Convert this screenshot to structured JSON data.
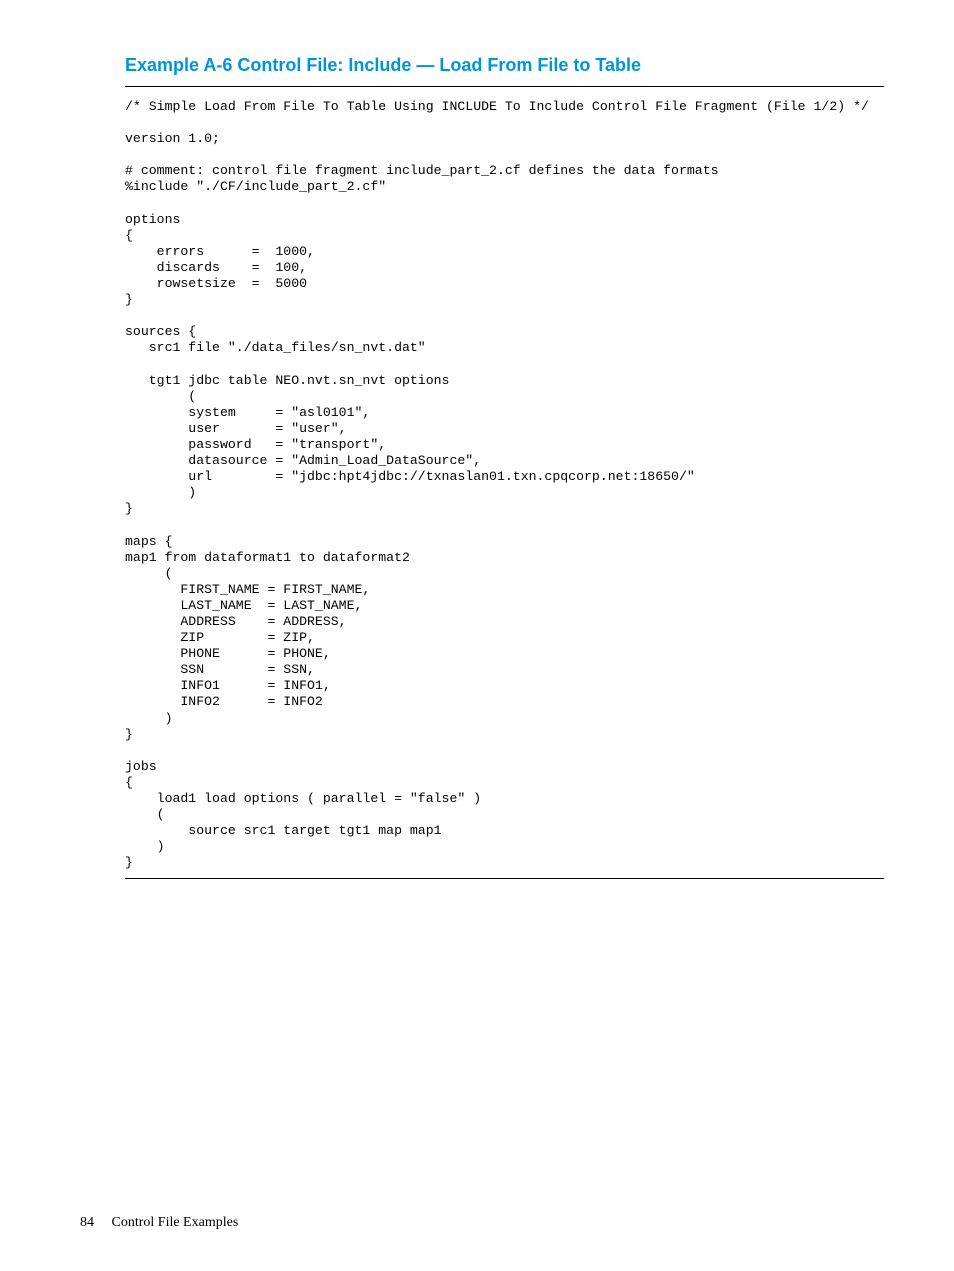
{
  "title": "Example  A-6 Control File: Include — Load From File to Table",
  "code": "/* Simple Load From File To Table Using INCLUDE To Include Control File Fragment (File 1/2) */\n\nversion 1.0;\n\n# comment: control file fragment include_part_2.cf defines the data formats\n%include \"./CF/include_part_2.cf\"\n\noptions\n{\n    errors      =  1000,\n    discards    =  100,\n    rowsetsize  =  5000\n}\n\nsources {\n   src1 file \"./data_files/sn_nvt.dat\"\n\n   tgt1 jdbc table NEO.nvt.sn_nvt options\n        (\n        system     = \"asl0101\",\n        user       = \"user\",\n        password   = \"transport\",\n        datasource = \"Admin_Load_DataSource\",\n        url        = \"jdbc:hpt4jdbc://txnaslan01.txn.cpqcorp.net:18650/\"\n        )\n}\n\nmaps {\nmap1 from dataformat1 to dataformat2\n     (\n       FIRST_NAME = FIRST_NAME,\n       LAST_NAME  = LAST_NAME,\n       ADDRESS    = ADDRESS,\n       ZIP        = ZIP,\n       PHONE      = PHONE,\n       SSN        = SSN,\n       INFO1      = INFO1,\n       INFO2      = INFO2\n     )\n}\n\njobs\n{\n    load1 load options ( parallel = \"false\" )\n    (\n        source src1 target tgt1 map map1\n    )\n}",
  "footer": {
    "page_number": "84",
    "section": "Control File Examples"
  }
}
